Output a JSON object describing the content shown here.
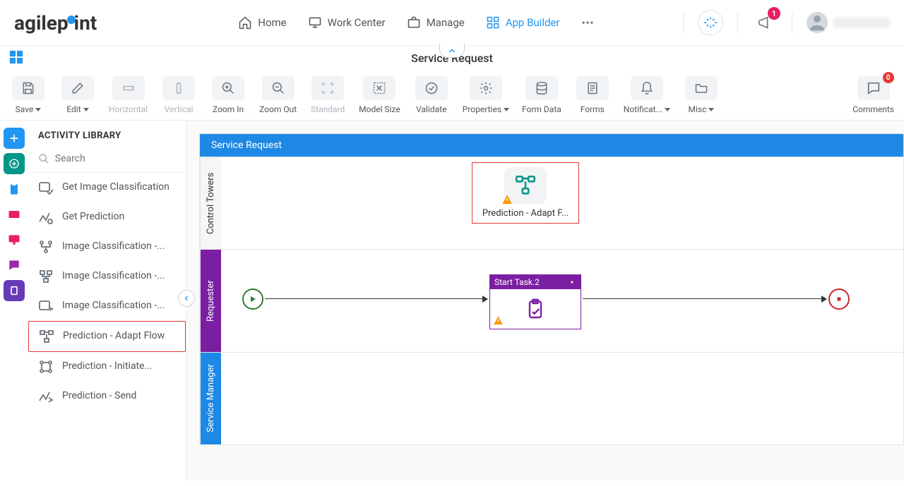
{
  "header": {
    "nav": [
      {
        "label": "Home"
      },
      {
        "label": "Work Center"
      },
      {
        "label": "Manage"
      },
      {
        "label": "App Builder"
      }
    ],
    "notification_count": "1"
  },
  "page_title": "Service Request",
  "toolbar": {
    "save": "Save",
    "edit": "Edit",
    "horizontal": "Horizontal",
    "vertical": "Vertical",
    "zoom_in": "Zoom In",
    "zoom_out": "Zoom Out",
    "standard": "Standard",
    "model_size": "Model Size",
    "validate": "Validate",
    "properties": "Properties",
    "form_data": "Form Data",
    "forms": "Forms",
    "notifications": "Notificat...",
    "misc": "Misc",
    "comments": "Comments",
    "comments_count": "0"
  },
  "library": {
    "title": "ACTIVITY LIBRARY",
    "search_placeholder": "Search",
    "items": [
      {
        "label": "Get Image Classification"
      },
      {
        "label": "Get Prediction"
      },
      {
        "label": "Image Classification -..."
      },
      {
        "label": "Image Classification -..."
      },
      {
        "label": "Image Classification -..."
      },
      {
        "label": "Prediction - Adapt Flow"
      },
      {
        "label": "Prediction - Initiate..."
      },
      {
        "label": "Prediction - Send"
      }
    ]
  },
  "canvas": {
    "process_name": "Service Request",
    "lanes": [
      {
        "label": "Control Towers"
      },
      {
        "label": "Requester"
      },
      {
        "label": "Service Manager"
      }
    ],
    "activity": {
      "label": "Prediction - Adapt F..."
    },
    "task": {
      "label": "Start Task.2"
    }
  }
}
